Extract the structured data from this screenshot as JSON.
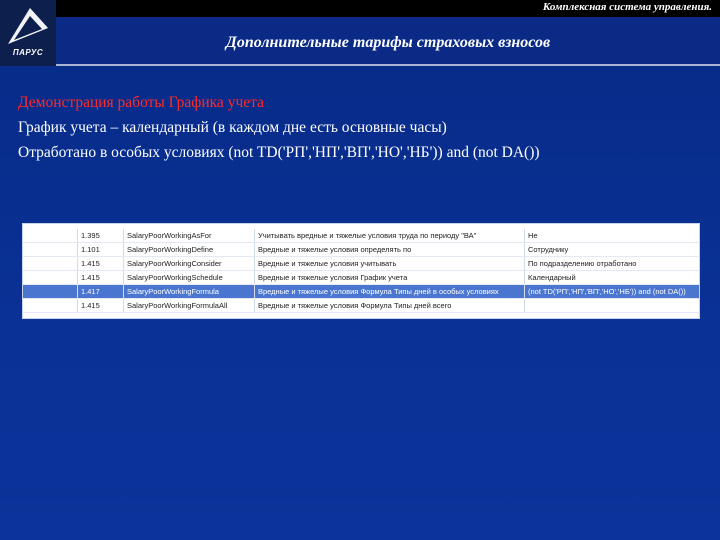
{
  "header": {
    "logo_text": "ПАРУС",
    "system_name": "Комплексная система управления.",
    "title": "Дополнительные тарифы страховых взносов"
  },
  "content": {
    "lines": [
      "Демонстрация работы Графика учета",
      "График учета – календарный (в каждом дне есть основные часы)",
      "Отработано в особых условиях (not TD('РП','НП','ВП','НО','НБ')) and (not DA())"
    ]
  },
  "table": {
    "rows": [
      {
        "code": "1.395",
        "name": "SalaryPoorWorkingAsFor",
        "description": "Учитывать вредные и тяжелые условия труда по периоду \"ВА\"",
        "value": "Не",
        "selected": false
      },
      {
        "code": "1.101",
        "name": "SalaryPoorWorkingDefine",
        "description": "Вредные и тяжелые условия определять по",
        "value": "Сотруднику",
        "selected": false
      },
      {
        "code": "1.415",
        "name": "SalaryPoorWorkingConsider",
        "description": "Вредные и тяжелые условия учитывать",
        "value": "По подразделению отработано",
        "selected": false
      },
      {
        "code": "1.415",
        "name": "SalaryPoorWorkingSchedule",
        "description": "Вредные и тяжелые условия График учета",
        "value": "Календарный",
        "selected": false
      },
      {
        "code": "1.417",
        "name": "SalaryPoorWorkingFormula",
        "description": "Вредные и тяжелые условия Формула Типы дней в особых условиях",
        "value": "(not TD('РП','НП','ВП','НО','НБ')) and (not DA())",
        "selected": true
      },
      {
        "code": "1.415",
        "name": "SalaryPoorWorkingFormulaAll",
        "description": "Вредные и тяжелые условия Формула Типы дней всего",
        "value": "",
        "selected": false
      }
    ]
  },
  "colors": {
    "background": "#0a3196",
    "highlight_text": "#ff2a2a",
    "selected_row": "#4a76d0"
  }
}
